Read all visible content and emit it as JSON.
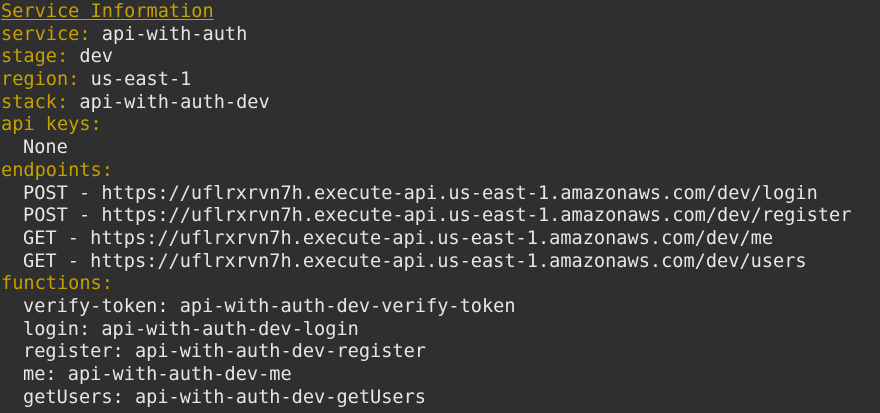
{
  "title": "Service Information",
  "fields": [
    {
      "key": "service:",
      "value": "api-with-auth"
    },
    {
      "key": "stage:",
      "value": "dev"
    },
    {
      "key": "region:",
      "value": "us-east-1"
    },
    {
      "key": "stack:",
      "value": "api-with-auth-dev"
    }
  ],
  "api_keys": {
    "label": "api keys:",
    "items": [
      "None"
    ]
  },
  "endpoints": {
    "label": "endpoints:",
    "items": [
      "POST - https://uflrxrvn7h.execute-api.us-east-1.amazonaws.com/dev/login",
      "POST - https://uflrxrvn7h.execute-api.us-east-1.amazonaws.com/dev/register",
      "GET - https://uflrxrvn7h.execute-api.us-east-1.amazonaws.com/dev/me",
      "GET - https://uflrxrvn7h.execute-api.us-east-1.amazonaws.com/dev/users"
    ]
  },
  "functions": {
    "label": "functions:",
    "items": [
      "verify-token: api-with-auth-dev-verify-token",
      "login: api-with-auth-dev-login",
      "register: api-with-auth-dev-register",
      "me: api-with-auth-dev-me",
      "getUsers: api-with-auth-dev-getUsers"
    ]
  },
  "colors": {
    "background": "#2f2f2f",
    "key": "#c4a000",
    "text": "#e6e6e6"
  }
}
